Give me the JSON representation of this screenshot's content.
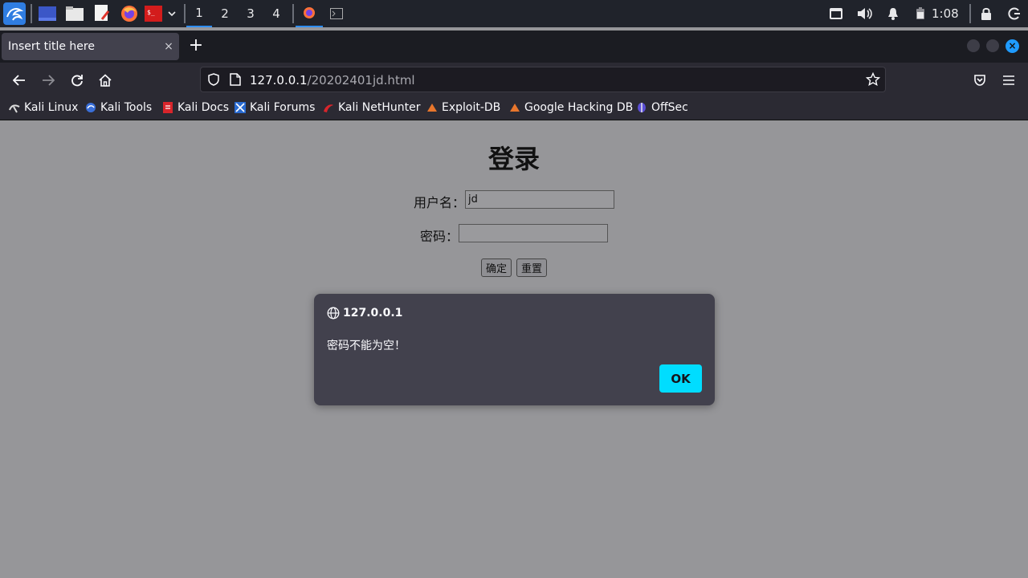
{
  "panel": {
    "workspaces": [
      "1",
      "2",
      "3",
      "4"
    ],
    "active_workspace": "1",
    "clock": "1:08"
  },
  "browser": {
    "tab_title": "Insert title here",
    "tab_close": "×",
    "new_tab": "+",
    "url_host": "127.0.0.1",
    "url_path": "/20202401jd.html",
    "bookmarks": [
      "Kali Linux",
      "Kali Tools",
      "Kali Docs",
      "Kali Forums",
      "Kali NetHunter",
      "Exploit-DB",
      "Google Hacking DB",
      "OffSec"
    ]
  },
  "page": {
    "title": "登录",
    "username_label": "用户名：",
    "username_value": "jd",
    "password_label": "密码：",
    "password_value": "",
    "submit_label": "确定",
    "reset_label": "重置"
  },
  "dialog": {
    "origin": "127.0.0.1",
    "message": "密码不能为空！",
    "ok_label": "OK"
  },
  "colors": {
    "accent": "#00ddff",
    "page_bg": "#969699",
    "dialog_bg": "#42414d"
  }
}
